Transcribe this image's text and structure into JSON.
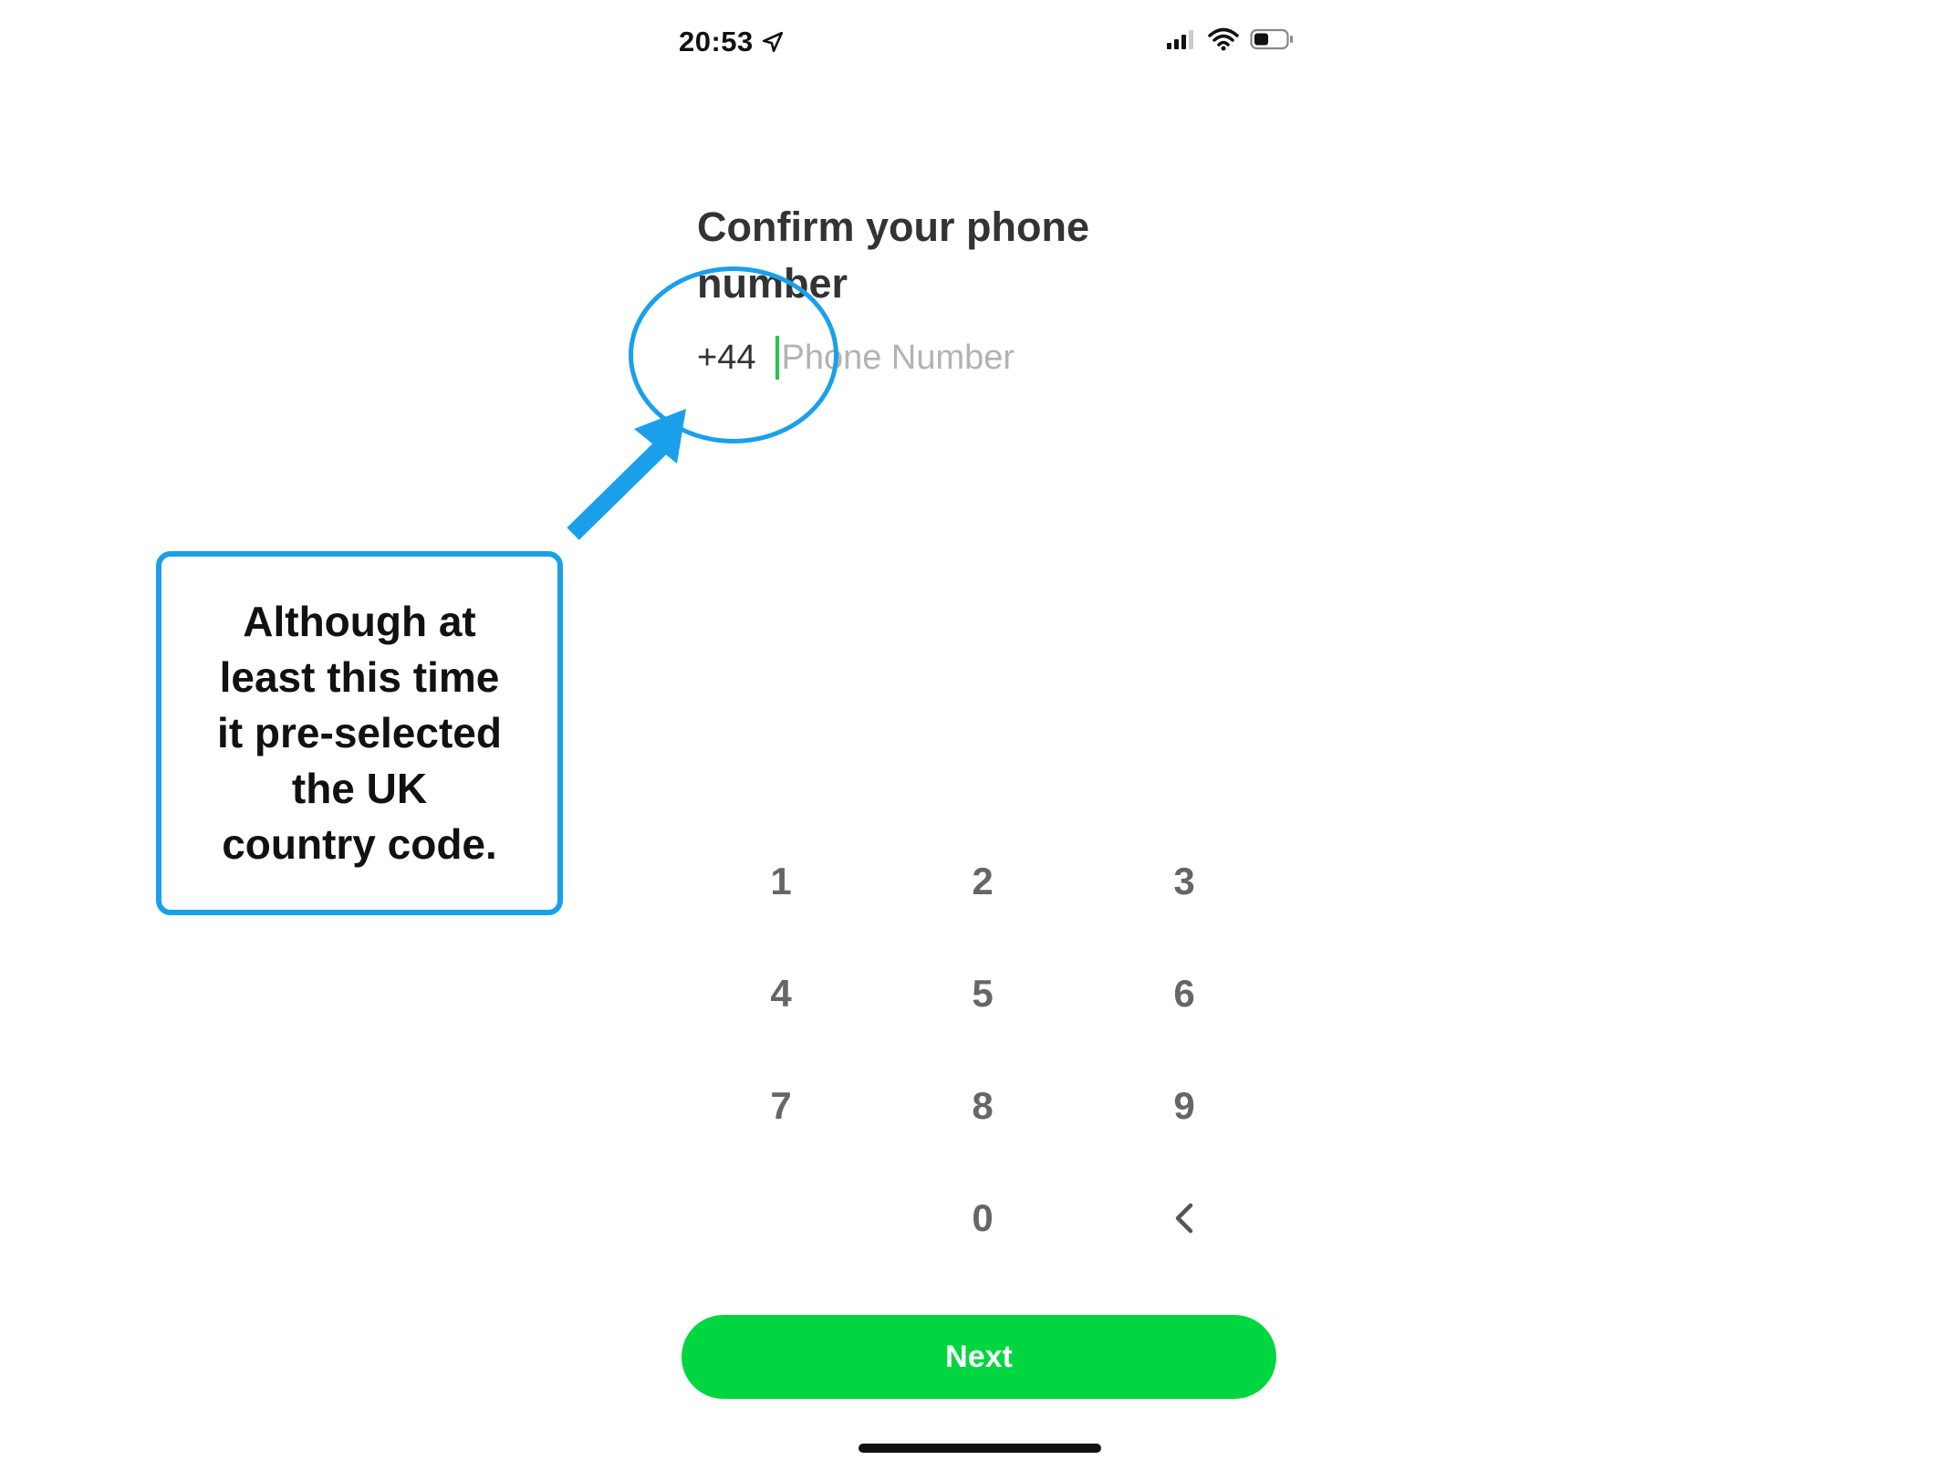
{
  "status_bar": {
    "time": "20:53",
    "icons": [
      "location-arrow-icon",
      "cellular-signal-icon",
      "wifi-icon",
      "battery-icon"
    ]
  },
  "screen": {
    "title": "Confirm your phone number",
    "country_code": "+44",
    "phone_placeholder": "Phone Number",
    "phone_value": ""
  },
  "keypad": {
    "keys": [
      "1",
      "2",
      "3",
      "4",
      "5",
      "6",
      "7",
      "8",
      "9",
      "0"
    ],
    "backspace_icon": "chevron-left-icon"
  },
  "actions": {
    "next_label": "Next"
  },
  "annotation": {
    "text": "Although at\nleast this time\nit pre-selected\nthe UK\ncountry code.",
    "color": "#1aa0ea"
  },
  "colors": {
    "accent": "#00d640",
    "caret": "#2fc24a",
    "annotation": "#1aa0ea"
  }
}
